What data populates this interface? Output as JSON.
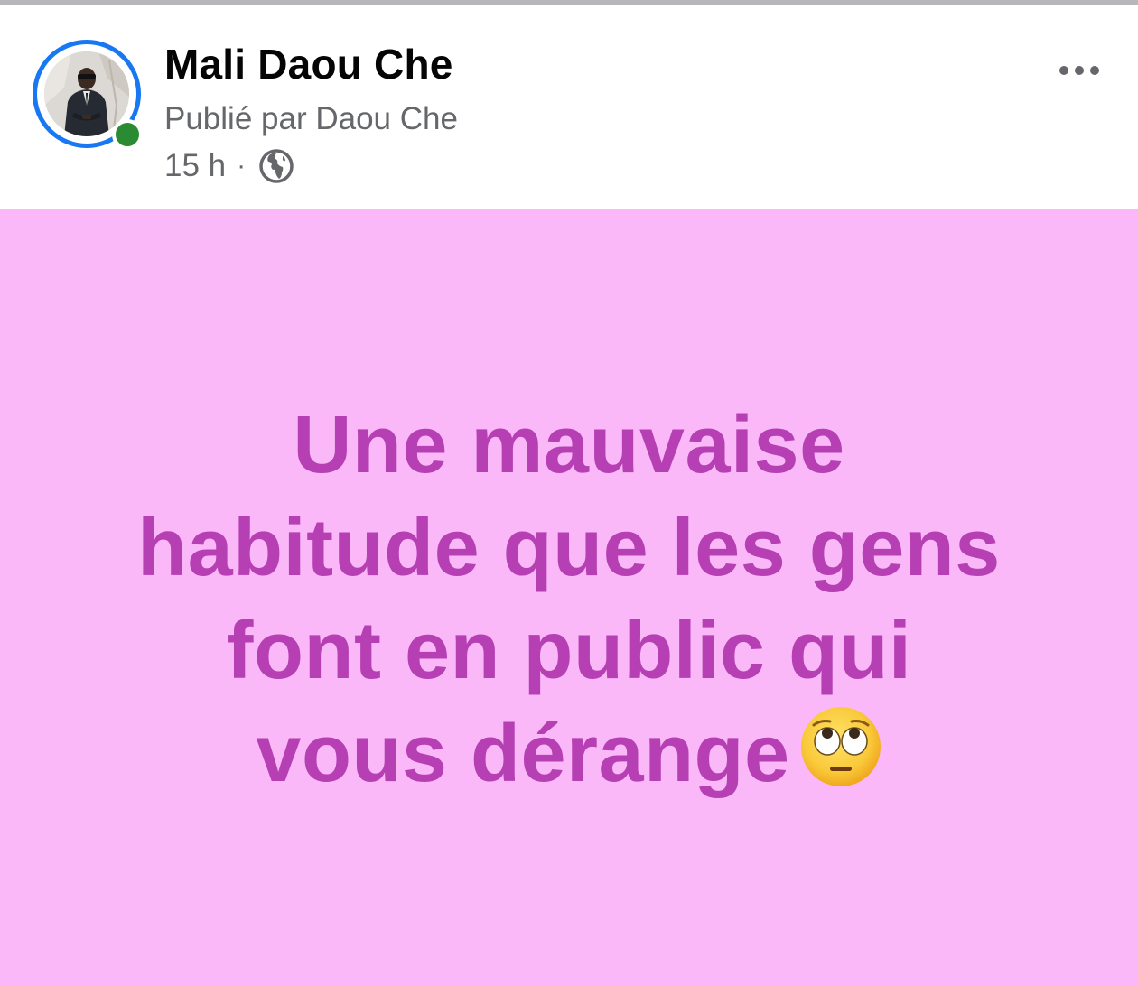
{
  "post": {
    "author_name": "Mali Daou Che",
    "published_by": "Publié par Daou Che",
    "time_ago": "15 h",
    "separator": "·",
    "audience_icon": "globe-icon",
    "more_icon": "more-options-icon",
    "online_status_color": "#2a8b33",
    "story_ring_color": "#1877f2"
  },
  "body": {
    "background_color": "#fbb8f9",
    "text_color": "#b640b3",
    "lines": [
      "Une mauvaise",
      "habitude que les gens",
      "font en public qui",
      "vous dérange"
    ],
    "emoji": "face-with-rolling-eyes-icon"
  }
}
